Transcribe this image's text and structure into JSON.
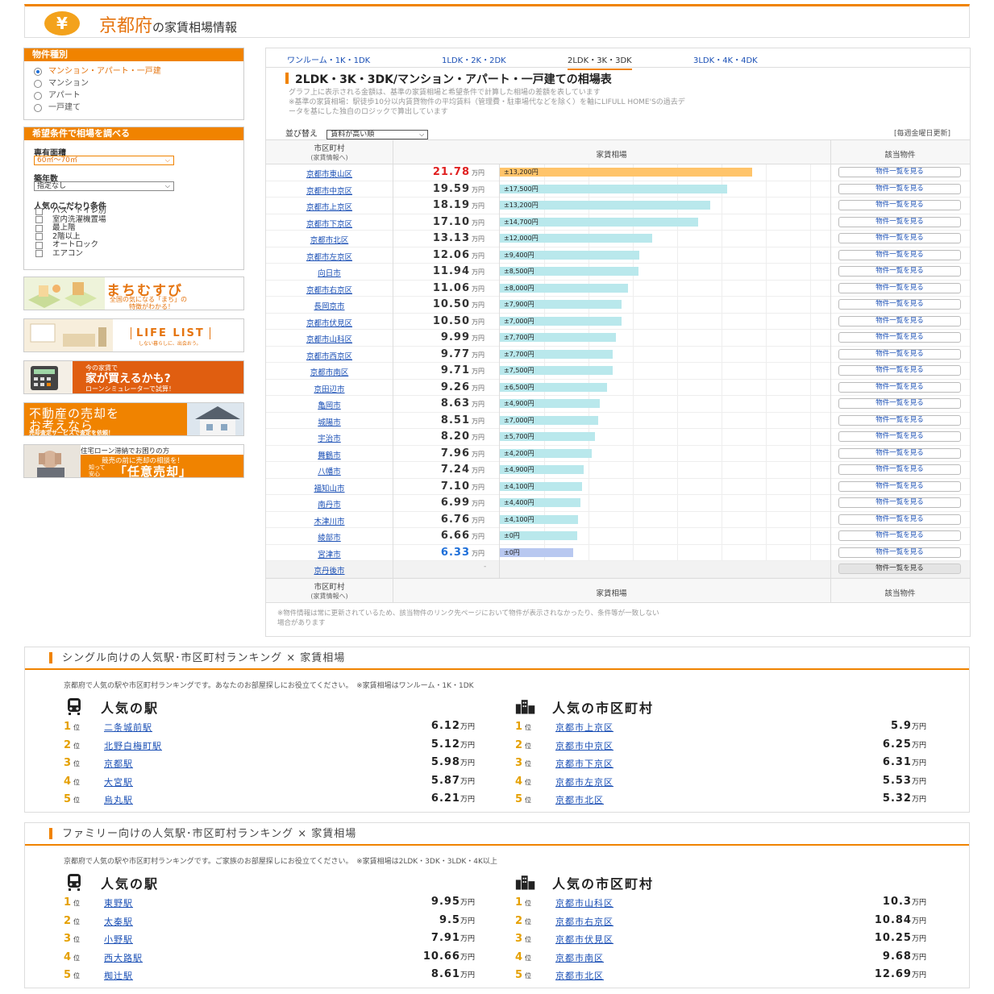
{
  "header": {
    "title": "京都府",
    "title_suffix": "の家賃相場情報",
    "logo_symbol": "¥"
  },
  "sidebar": {
    "property_type": {
      "heading": "物件種別",
      "options": [
        {
          "label": "マンション・アパート・一戸建",
          "selected": true
        },
        {
          "label": "マンション",
          "selected": false
        },
        {
          "label": "アパート",
          "selected": false
        },
        {
          "label": "一戸建て",
          "selected": false
        }
      ]
    },
    "conditions": {
      "heading": "希望条件で相場を調べる",
      "area_label": "専有面積",
      "area_value": "60㎡～70㎡",
      "age_label": "築年数",
      "age_value": "指定なし",
      "popular_label": "人気のこだわり条件",
      "checks": [
        "バス・トイレ別",
        "室内洗濯機置場",
        "最上階",
        "2階以上",
        "オートロック",
        "エアコン"
      ]
    },
    "banners": {
      "machimusubi_title": "まちむすび",
      "machimusubi_sub1": "全国の気になる「まち」の",
      "machimusubi_sub2": "特徴がわかる！",
      "lifelist_title": "LIFE LIST",
      "lifelist_sub": "しない暮らしに、出会おう。",
      "loan_line1": "今の家賃で",
      "loan_line2": "家が買えるかも?",
      "loan_line3": "ローンシミュレーターで試算！",
      "sell_line1": "不動産の売却を",
      "sell_line2": "お考えなら",
      "sell_line3": "売却査定サービスで査定を依頼！",
      "ninbai_line1": "住宅ローン滞納でお困りの方",
      "ninbai_line2": "競売の前に売却の相談を！",
      "ninbai_small1": "知って",
      "ninbai_small2": "安心",
      "ninbai_big": "「任意売却」"
    }
  },
  "main": {
    "tabs": [
      "ワンルーム・1K・1DK",
      "1LDK・2K・2DK",
      "2LDK・3K・3DK",
      "3LDK・4K・4DK"
    ],
    "title": "2LDK・3K・3DK/マンション・アパート・一戸建ての相場表",
    "desc1": "グラフ上に表示される金額は、基準の家賃相場と希望条件で計算した相場の差額を表しています",
    "desc2": "※基準の家賃相場：駅徒歩10分以内賃貸物件の平均賃料（管理費・駐車場代などを除く）を軸にLIFULL HOME'Sの過去デ",
    "desc3": "ータを基にした独自のロジックで算出しています",
    "sort_label": "並び替え",
    "sort_value": "賃料が高い順",
    "update": "[毎週金曜日更新]",
    "col_city": "市区町村",
    "col_city_sub": "(家賃情報へ)",
    "col_rent": "家賃相場",
    "col_listing": "該当物件",
    "unit": "万円",
    "list_button": "物件一覧を見る",
    "note1": "※物件情報は常に更新されているため、該当物件のリンク先ページにおいて物件が表示されなかったり、条件等が一致しない",
    "note2": "場合があります"
  },
  "chart_data": {
    "type": "bar",
    "xlabel": "市区町村",
    "ylabel": "家賃相場",
    "categories": [
      "京都市東山区",
      "京都市中京区",
      "京都市上京区",
      "京都市下京区",
      "京都市北区",
      "京都市左京区",
      "向日市",
      "京都市右京区",
      "長岡京市",
      "京都市伏見区",
      "京都市山科区",
      "京都市西京区",
      "京都市南区",
      "京田辺市",
      "亀岡市",
      "城陽市",
      "宇治市",
      "舞鶴市",
      "八幡市",
      "福知山市",
      "南丹市",
      "木津川市",
      "綾部市",
      "宮津市",
      "京丹後市"
    ],
    "values": [
      "21.78",
      "19.59",
      "18.19",
      "17.10",
      "13.13",
      "12.06",
      "11.94",
      "11.06",
      "10.50",
      "10.50",
      "9.99",
      "9.77",
      "9.71",
      "9.26",
      "8.63",
      "8.51",
      "8.20",
      "7.96",
      "7.24",
      "7.10",
      "6.99",
      "6.76",
      "6.66",
      "6.33",
      null
    ],
    "diffs": [
      "±13,200円",
      "±17,500円",
      "±13,200円",
      "±14,700円",
      "±12,000円",
      "±9,400円",
      "±8,500円",
      "±8,000円",
      "±7,900円",
      "±7,000円",
      "±7,700円",
      "±7,700円",
      "±7,500円",
      "±6,500円",
      "±4,900円",
      "±7,000円",
      "±5,700円",
      "±4,200円",
      "±4,900円",
      "±4,100円",
      "±4,400円",
      "±4,100円",
      "±0円",
      "±0円",
      ""
    ],
    "missing_value_label": "-"
  },
  "single_ranking": {
    "title": "シングル向けの人気駅･市区町村ランキング × 家賃相場",
    "desc": "京都府で人気の駅や市区町村ランキングです。あなたのお部屋探しにお役立てください。　※家賃相場はワンルーム・1K・1DK",
    "stations_title": "人気の駅",
    "cities_title": "人気の市区町村",
    "rank_suffix": "位",
    "unit": "万円",
    "stations": [
      {
        "rank": "1",
        "name": "二条城前駅",
        "value": "6.12"
      },
      {
        "rank": "2",
        "name": "北野白梅町駅",
        "value": "5.12"
      },
      {
        "rank": "3",
        "name": "京都駅",
        "value": "5.98"
      },
      {
        "rank": "4",
        "name": "大宮駅",
        "value": "5.87"
      },
      {
        "rank": "5",
        "name": "烏丸駅",
        "value": "6.21"
      }
    ],
    "cities": [
      {
        "rank": "1",
        "name": "京都市上京区",
        "value": "5.9"
      },
      {
        "rank": "2",
        "name": "京都市中京区",
        "value": "6.25"
      },
      {
        "rank": "3",
        "name": "京都市下京区",
        "value": "6.31"
      },
      {
        "rank": "4",
        "name": "京都市左京区",
        "value": "5.53"
      },
      {
        "rank": "5",
        "name": "京都市北区",
        "value": "5.32"
      }
    ]
  },
  "family_ranking": {
    "title": "ファミリー向けの人気駅･市区町村ランキング × 家賃相場",
    "desc": "京都府で人気の駅や市区町村ランキングです。ご家族のお部屋探しにお役立てください。　※家賃相場は2LDK・3DK・3LDK・4K以上",
    "stations_title": "人気の駅",
    "cities_title": "人気の市区町村",
    "rank_suffix": "位",
    "unit": "万円",
    "stations": [
      {
        "rank": "1",
        "name": "東野駅",
        "value": "9.95"
      },
      {
        "rank": "2",
        "name": "太秦駅",
        "value": "9.5"
      },
      {
        "rank": "3",
        "name": "小野駅",
        "value": "7.91"
      },
      {
        "rank": "4",
        "name": "西大路駅",
        "value": "10.66"
      },
      {
        "rank": "5",
        "name": "椥辻駅",
        "value": "8.61"
      }
    ],
    "cities": [
      {
        "rank": "1",
        "name": "京都市山科区",
        "value": "10.3"
      },
      {
        "rank": "2",
        "name": "京都市右京区",
        "value": "10.84"
      },
      {
        "rank": "3",
        "name": "京都市伏見区",
        "value": "10.25"
      },
      {
        "rank": "4",
        "name": "京都市南区",
        "value": "9.68"
      },
      {
        "rank": "5",
        "name": "京都市北区",
        "value": "12.69"
      }
    ]
  },
  "colors": {
    "accent": "#f08300",
    "link": "#1a4fb5",
    "bar": "#b9e8ec",
    "bar_high": "#ffc46a",
    "bar_low": "#b8c8f0",
    "rent_high": "#e02020",
    "rent_low": "#1e6fd9"
  }
}
